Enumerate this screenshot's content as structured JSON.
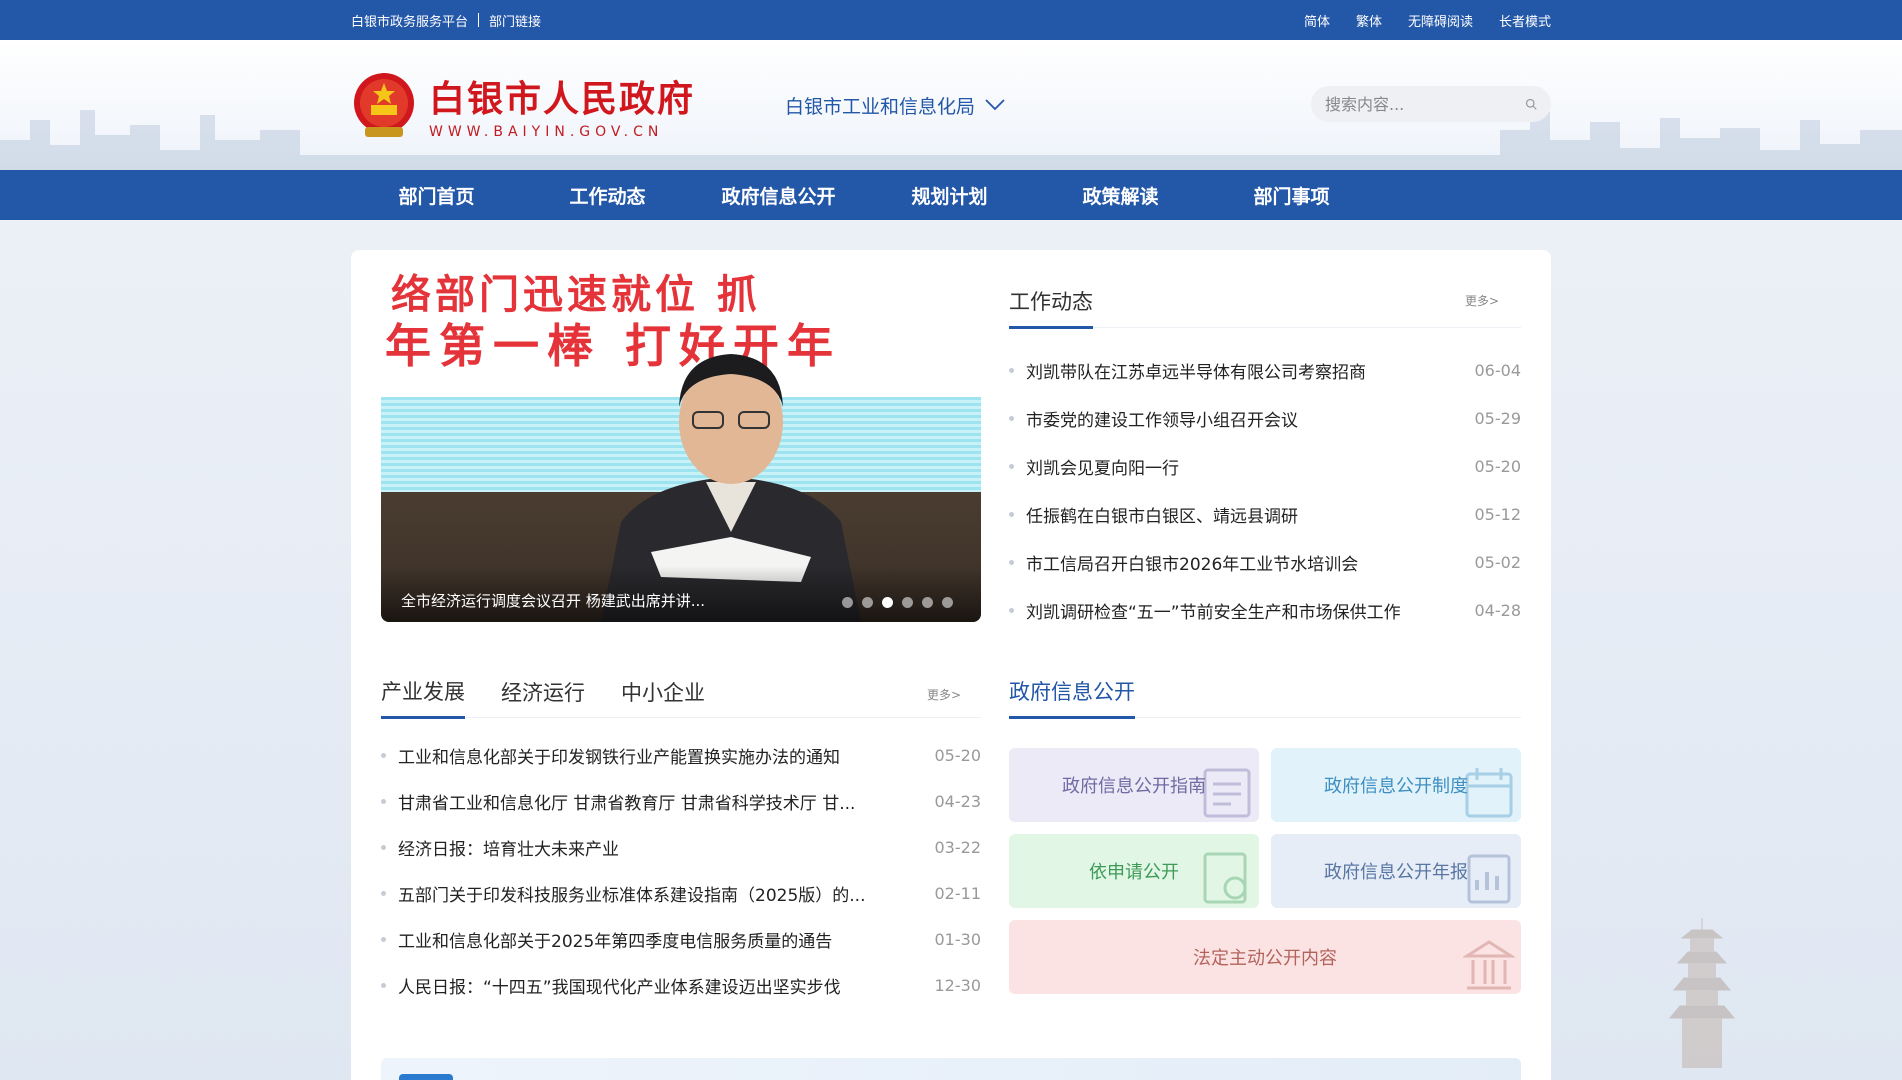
{
  "topbar": {
    "platform": "白银市政务服务平台",
    "dept_links": "部门链接",
    "simplified": "简体",
    "traditional": "繁体",
    "accessible": "无障碍阅读",
    "elderly": "长者模式"
  },
  "header": {
    "site_name": "白银市人民政府",
    "site_url": "WWW.BAIYIN.GOV.CN",
    "department": "白银市工业和信息化局",
    "search_placeholder": "搜索内容..."
  },
  "nav": {
    "items": [
      "部门首页",
      "工作动态",
      "政府信息公开",
      "规划计划",
      "政策解读",
      "部门事项"
    ]
  },
  "carousel": {
    "banner_line1": "络部门迅速就位 抓",
    "banner_line2": "年第一棒 打好开年",
    "caption": "全市经济运行调度会议召开 杨建武出席并讲...",
    "slide_count": 6,
    "active_index": 2
  },
  "work_news": {
    "title": "工作动态",
    "more": "更多>",
    "items": [
      {
        "title": "刘凯带队在江苏卓远半导体有限公司考察招商",
        "date": "06-04"
      },
      {
        "title": "市委党的建设工作领导小组召开会议",
        "date": "05-29"
      },
      {
        "title": "刘凯会见夏向阳一行",
        "date": "05-20"
      },
      {
        "title": "任振鹤在白银市白银区、靖远县调研",
        "date": "05-12"
      },
      {
        "title": "市工信局召开白银市2026年工业节水培训会",
        "date": "05-02"
      },
      {
        "title": "刘凯调研检查“五一”节前安全生产和市场保供工作",
        "date": "04-28"
      }
    ]
  },
  "industry": {
    "tabs": [
      "产业发展",
      "经济运行",
      "中小企业"
    ],
    "active_tab": 0,
    "more": "更多>",
    "items": [
      {
        "title": "工业和信息化部关于印发钢铁行业产能置换实施办法的通知",
        "date": "05-20"
      },
      {
        "title": "甘肃省工业和信息化厅 甘肃省教育厅 甘肃省科学技术厅 甘...",
        "date": "04-23"
      },
      {
        "title": "经济日报：培育壮大未来产业",
        "date": "03-22"
      },
      {
        "title": "五部门关于印发科技服务业标准体系建设指南（2025版）的...",
        "date": "02-11"
      },
      {
        "title": "工业和信息化部关于2025年第四季度电信服务质量的通告",
        "date": "01-30"
      },
      {
        "title": "人民日报：“十四五”我国现代化产业体系建设迈出坚实步伐",
        "date": "12-30"
      }
    ]
  },
  "gov_info": {
    "title": "政府信息公开",
    "cards": [
      "政府信息公开指南",
      "政府信息公开制度",
      "依申请公开",
      "政府信息公开年报",
      "法定主动公开内容"
    ]
  },
  "colors": {
    "brand_blue": "#2357a8",
    "logo_red": "#d0171d"
  }
}
